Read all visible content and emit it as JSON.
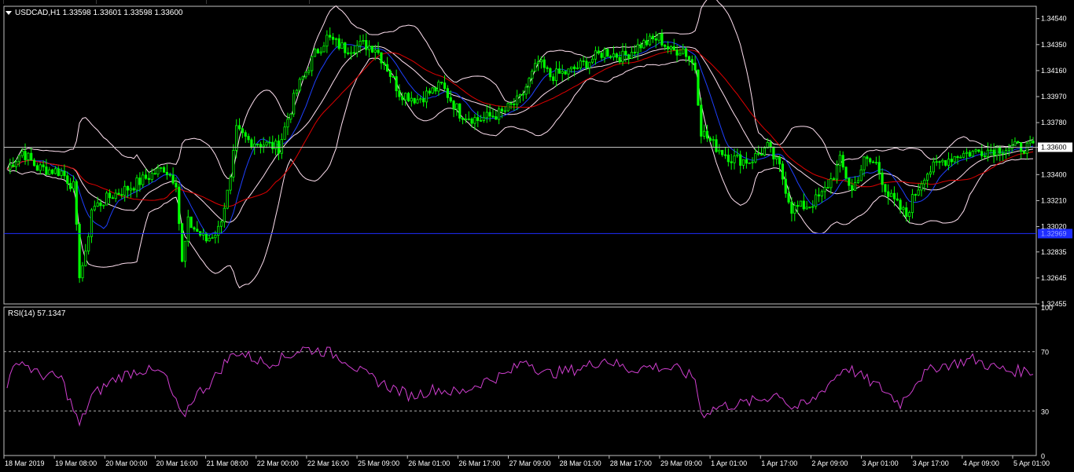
{
  "header": {
    "symbol": "USDCAD,H1",
    "ohlc": "1.33598 1.33601 1.33598 1.33600",
    "title": "USDCAD,H1  1.33598 1.33601 1.33598 1.33600"
  },
  "rsi_header": "RSI(14) 57.1347",
  "colors": {
    "background": "#000000",
    "frame": "#c0c0c0",
    "bull": "#00ff00",
    "bear": "#00ff00",
    "boll": "#ffe0f0",
    "ma_blue": "#1e40ff",
    "ma_red": "#e00000",
    "rsi": "#d03fd0",
    "price_line": "#c0c0c0",
    "level_line": "#1e2dff"
  },
  "chart_data": [
    {
      "type": "candlestick",
      "title": "USDCAD,H1",
      "ylim": [
        1.32455,
        1.3463
      ],
      "y_ticks": [
        "1.34540",
        "1.34350",
        "1.34160",
        "1.33970",
        "1.33780",
        "1.33600",
        "1.33400",
        "1.33210",
        "1.33020",
        "1.32835",
        "1.32645",
        "1.32455"
      ],
      "current_price": "1.33600",
      "level_line_price": "1.32969",
      "x_labels": [
        "18 Mar 2019",
        "19 Mar 08:00",
        "20 Mar 00:00",
        "20 Mar 16:00",
        "21 Mar 08:00",
        "22 Mar 00:00",
        "22 Mar 16:00",
        "25 Mar 09:00",
        "26 Mar 01:00",
        "26 Mar 17:00",
        "27 Mar 09:00",
        "28 Mar 01:00",
        "28 Mar 17:00",
        "29 Mar 09:00",
        "1 Apr 01:00",
        "1 Apr 17:00",
        "2 Apr 09:00",
        "3 Apr 01:00",
        "3 Apr 17:00",
        "4 Apr 09:00",
        "5 Apr 01:00"
      ],
      "price_path": [
        [
          0,
          1.3344
        ],
        [
          5,
          1.3357
        ],
        [
          10,
          1.3345
        ],
        [
          18,
          1.3342
        ],
        [
          22,
          1.3331
        ],
        [
          24,
          1.3268
        ],
        [
          26,
          1.328
        ],
        [
          28,
          1.3315
        ],
        [
          35,
          1.3325
        ],
        [
          40,
          1.333
        ],
        [
          48,
          1.334
        ],
        [
          52,
          1.3345
        ],
        [
          56,
          1.3335
        ],
        [
          58,
          1.3275
        ],
        [
          60,
          1.3305
        ],
        [
          66,
          1.3292
        ],
        [
          70,
          1.33
        ],
        [
          74,
          1.3335
        ],
        [
          76,
          1.3372
        ],
        [
          80,
          1.3365
        ],
        [
          86,
          1.3362
        ],
        [
          90,
          1.336
        ],
        [
          96,
          1.3402
        ],
        [
          102,
          1.3428
        ],
        [
          106,
          1.344
        ],
        [
          112,
          1.3432
        ],
        [
          118,
          1.3435
        ],
        [
          122,
          1.3433
        ],
        [
          126,
          1.3418
        ],
        [
          130,
          1.34
        ],
        [
          136,
          1.3395
        ],
        [
          144,
          1.3405
        ],
        [
          150,
          1.3385
        ],
        [
          156,
          1.338
        ],
        [
          164,
          1.3385
        ],
        [
          170,
          1.3395
        ],
        [
          176,
          1.3422
        ],
        [
          180,
          1.3412
        ],
        [
          186,
          1.3415
        ],
        [
          192,
          1.3422
        ],
        [
          198,
          1.343
        ],
        [
          204,
          1.3426
        ],
        [
          210,
          1.3435
        ],
        [
          216,
          1.344
        ],
        [
          220,
          1.343
        ],
        [
          224,
          1.3432
        ],
        [
          228,
          1.3418
        ],
        [
          230,
          1.3372
        ],
        [
          234,
          1.3362
        ],
        [
          240,
          1.3352
        ],
        [
          246,
          1.335
        ],
        [
          252,
          1.336
        ],
        [
          256,
          1.3345
        ],
        [
          260,
          1.3315
        ],
        [
          266,
          1.3318
        ],
        [
          270,
          1.3325
        ],
        [
          274,
          1.334
        ],
        [
          276,
          1.335
        ],
        [
          280,
          1.3328
        ],
        [
          284,
          1.335
        ],
        [
          288,
          1.3348
        ],
        [
          292,
          1.3325
        ],
        [
          298,
          1.331
        ],
        [
          300,
          1.3322
        ],
        [
          304,
          1.334
        ],
        [
          310,
          1.335
        ],
        [
          316,
          1.3355
        ],
        [
          322,
          1.3357
        ],
        [
          328,
          1.3359
        ],
        [
          334,
          1.336
        ],
        [
          340,
          1.336
        ]
      ],
      "series": [
        {
          "name": "Bollinger Bands"
        },
        {
          "name": "Moving Average (blue)"
        },
        {
          "name": "Moving Average (red)"
        }
      ]
    },
    {
      "type": "line",
      "title": "RSI(14) 57.1347",
      "ylim": [
        0,
        100
      ],
      "y_ticks": [
        "100",
        "70",
        "30",
        "0"
      ],
      "levels": [
        70,
        30
      ],
      "value_path": [
        [
          0,
          48
        ],
        [
          4,
          65
        ],
        [
          10,
          55
        ],
        [
          18,
          52
        ],
        [
          24,
          20
        ],
        [
          28,
          40
        ],
        [
          36,
          52
        ],
        [
          44,
          58
        ],
        [
          52,
          55
        ],
        [
          58,
          25
        ],
        [
          62,
          40
        ],
        [
          68,
          50
        ],
        [
          72,
          62
        ],
        [
          76,
          70
        ],
        [
          86,
          62
        ],
        [
          92,
          66
        ],
        [
          98,
          72
        ],
        [
          106,
          70
        ],
        [
          112,
          65
        ],
        [
          118,
          55
        ],
        [
          126,
          47
        ],
        [
          134,
          40
        ],
        [
          142,
          45
        ],
        [
          150,
          42
        ],
        [
          158,
          50
        ],
        [
          166,
          55
        ],
        [
          172,
          65
        ],
        [
          178,
          55
        ],
        [
          186,
          57
        ],
        [
          192,
          60
        ],
        [
          198,
          65
        ],
        [
          206,
          58
        ],
        [
          214,
          60
        ],
        [
          222,
          58
        ],
        [
          228,
          52
        ],
        [
          230,
          28
        ],
        [
          236,
          33
        ],
        [
          244,
          35
        ],
        [
          250,
          38
        ],
        [
          256,
          42
        ],
        [
          260,
          32
        ],
        [
          266,
          35
        ],
        [
          272,
          48
        ],
        [
          278,
          60
        ],
        [
          284,
          52
        ],
        [
          290,
          45
        ],
        [
          296,
          35
        ],
        [
          302,
          52
        ],
        [
          308,
          60
        ],
        [
          314,
          62
        ],
        [
          320,
          65
        ],
        [
          326,
          60
        ],
        [
          332,
          57
        ],
        [
          340,
          57
        ]
      ]
    }
  ]
}
